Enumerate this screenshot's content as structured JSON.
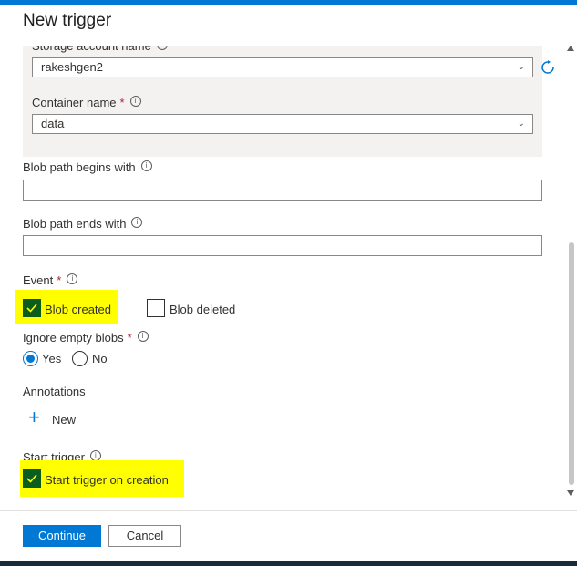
{
  "panel": {
    "title": "New trigger"
  },
  "storage": {
    "label": "Storage account name",
    "value": "rakeshgen2",
    "refresh_icon": "refresh-icon"
  },
  "container": {
    "label": "Container name",
    "required": "*",
    "value": "data"
  },
  "blob_begins": {
    "label": "Blob path begins with",
    "value": ""
  },
  "blob_ends": {
    "label": "Blob path ends with",
    "value": ""
  },
  "event": {
    "label": "Event",
    "required": "*",
    "options": [
      {
        "label": "Blob created",
        "checked": true
      },
      {
        "label": "Blob deleted",
        "checked": false
      }
    ]
  },
  "ignore_empty": {
    "label": "Ignore empty blobs",
    "required": "*",
    "options": [
      {
        "label": "Yes",
        "selected": true
      },
      {
        "label": "No",
        "selected": false
      }
    ]
  },
  "annotations": {
    "label": "Annotations",
    "new_label": "New"
  },
  "start_trigger": {
    "label": "Start trigger",
    "checkbox_label": "Start trigger on creation",
    "checked": true
  },
  "footer": {
    "continue_label": "Continue",
    "cancel_label": "Cancel"
  },
  "colors": {
    "accent": "#0078d4",
    "highlight": "#ffff00",
    "checked_fill": "#0b5d1e",
    "required": "#a4262c"
  }
}
